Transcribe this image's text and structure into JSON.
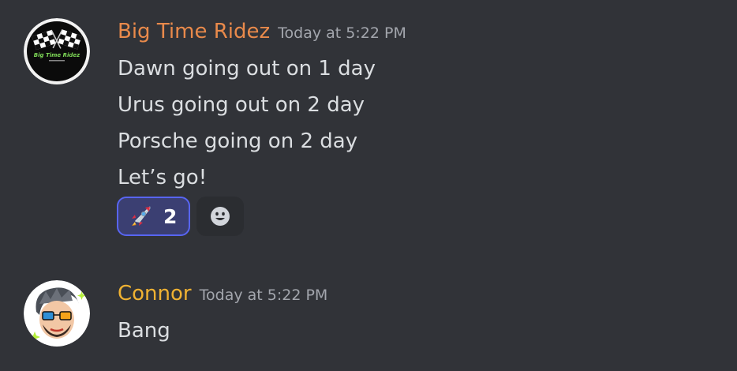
{
  "messages": [
    {
      "username": "Big Time Ridez",
      "username_color": "#e98a4b",
      "timestamp": "Today at 5:22 PM",
      "lines": [
        "Dawn going out on 1 day",
        "Urus going out on 2 day",
        "Porsche going on 2 day",
        "Let’s go!"
      ],
      "avatar_icon": "checkered-flags-logo",
      "avatar_logo_text": "Big Time Ridez",
      "reactions": [
        {
          "emoji": "rocket-icon",
          "count": "2",
          "active": true
        }
      ],
      "add_reaction_icon": "smiley-face-icon"
    },
    {
      "username": "Connor",
      "username_color": "#f0b232",
      "timestamp": "Today at 5:22 PM",
      "lines": [
        "Bang"
      ],
      "avatar_icon": "cartoon-character-avatar"
    }
  ],
  "colors": {
    "background": "#313338",
    "text": "#dbdee1",
    "timestamp": "#a3a6ad",
    "reaction_active_bg": "#3b3f72",
    "reaction_active_border": "#5865f2"
  }
}
